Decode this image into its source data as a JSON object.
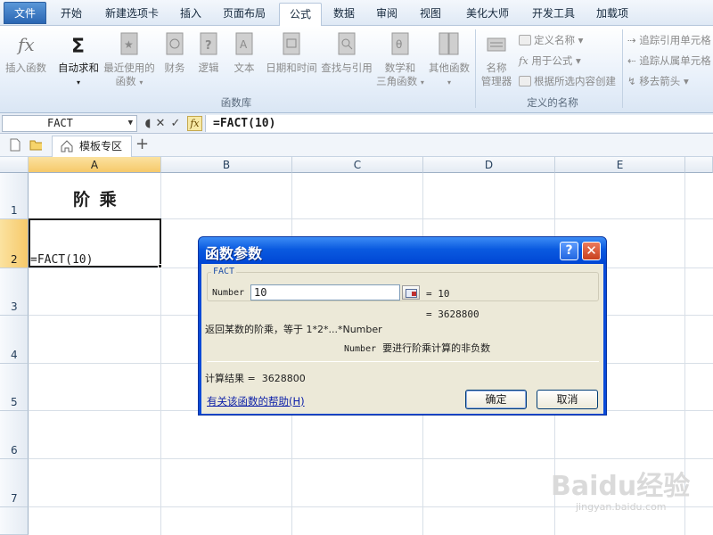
{
  "ribbon_tabs": [
    {
      "label": "文件"
    },
    {
      "label": "开始"
    },
    {
      "label": "新建选项卡"
    },
    {
      "label": "插入"
    },
    {
      "label": "页面布局"
    },
    {
      "label": "公式"
    },
    {
      "label": "数据"
    },
    {
      "label": "审阅"
    },
    {
      "label": "视图"
    },
    {
      "label": "美化大师"
    },
    {
      "label": "开发工具"
    },
    {
      "label": "加载项"
    }
  ],
  "active_tab": "公式",
  "ribbon": {
    "insert_function": "插入函数",
    "autosum": "自动求和",
    "recent_line1": "最近使用的",
    "recent_line2": "函数",
    "financial": "财务",
    "logical": "逻辑",
    "text": "文本",
    "datetime": "日期和时间",
    "lookup": "查找与引用",
    "math_line1": "数学和",
    "math_line2": "三角函数",
    "more": "其他函数",
    "group_library": "函数库",
    "name_manager_line1": "名称",
    "name_manager_line2": "管理器",
    "define_name": "定义名称",
    "use_in_formula": "用于公式",
    "create_from_selection": "根据所选内容创建",
    "group_names": "定义的名称",
    "trace_precedents": "追踪引用单元格",
    "trace_dependents": "追踪从属单元格",
    "remove_arrows": "移去箭头"
  },
  "formula_bar": {
    "name_box": "FACT",
    "formula": "=FACT(10)",
    "fx": "fx"
  },
  "doc_tabs": {
    "template_zone": "模板专区",
    "plus": "+"
  },
  "sheet": {
    "columns": [
      "A",
      "B",
      "C",
      "D",
      "E"
    ],
    "rows": [
      "1",
      "2",
      "3",
      "4",
      "5",
      "6",
      "7"
    ],
    "a1": "阶 乘",
    "a2": "=FACT(10)"
  },
  "dialog": {
    "title": "函数参数",
    "help_glyph": "?",
    "close_glyph": "✕",
    "function_name": "FACT",
    "arg_label": "Number",
    "arg_value": "10",
    "arg_result": "= 10",
    "func_result": "= 3628800",
    "description": "返回某数的阶乘，等于 1*2*...*Number",
    "arg_description_name": "Number",
    "arg_description": "要进行阶乘计算的非负数",
    "calc_result_label": "计算结果 =",
    "calc_result_value": "3628800",
    "help_link": "有关该函数的帮助(H)",
    "ok": "确定",
    "cancel": "取消"
  },
  "watermark": {
    "main": "Baidu经验",
    "sub": "jingyan.baidu.com"
  }
}
